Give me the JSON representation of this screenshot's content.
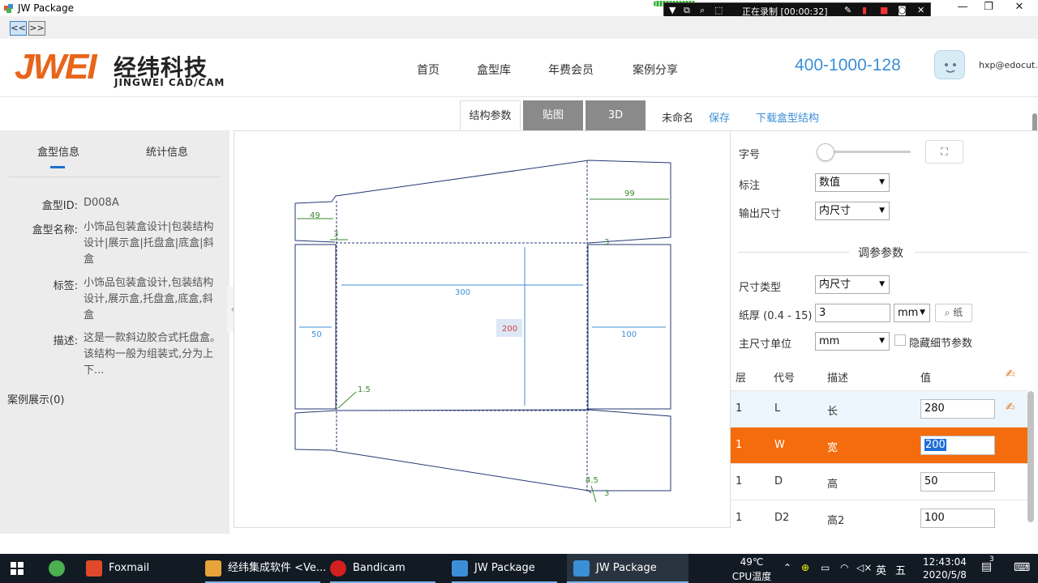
{
  "window": {
    "title": "JW Package",
    "minimize": "—",
    "maximize": "❐",
    "close": "✕"
  },
  "recorder": {
    "status": "正在录制 [00:00:32]"
  },
  "nav": {
    "back": "<<",
    "forward": ">>"
  },
  "header": {
    "logo_text": "JWEI",
    "logo_cn": "经纬科技",
    "logo_en": "JINGWEI CAD/CAM",
    "menu": [
      "首页",
      "盒型库",
      "年费会员",
      "案例分享"
    ],
    "phone": "400-1000-128",
    "email": "hxp@edocut."
  },
  "tabs": {
    "structure": "结构参数",
    "texture": "贴图",
    "three_d": "3D",
    "untitled": "未命名",
    "save": "保存",
    "download": "下载盒型结构"
  },
  "left": {
    "tab_info": "盒型信息",
    "tab_stats": "统计信息",
    "id_label": "盒型ID:",
    "id_value": "D008A",
    "name_label": "盒型名称:",
    "name_value": "小饰品包装盒设计|包装结构设计|展示盒|托盘盒|底盒|斜盒",
    "tags_label": "标签:",
    "tags_value": "小饰品包装盒设计,包装结构设计,展示盒,托盘盒,底盒,斜盒",
    "desc_label": "描述:",
    "desc_value": "这是一款斜边胶合式托盘盒。该结构一般为组装式,分为上下...",
    "cases": "案例展示(0)"
  },
  "canvas": {
    "dim_49": "49",
    "dim_99": "99",
    "dim_3a": "3",
    "dim_3b": "3",
    "dim_300": "300",
    "dim_200": "200",
    "dim_50": "50",
    "dim_100": "100",
    "dim_1_5": "1.5",
    "dim_4_5": "4.5",
    "dim_3c": "3"
  },
  "right": {
    "font_label": "字号",
    "mark_label": "标注",
    "mark_value": "数值",
    "output_label": "输出尺寸",
    "output_value": "内尺寸",
    "section": "调参参数",
    "dimtype_label": "尺寸类型",
    "dimtype_value": "内尺寸",
    "thick_label": "纸厚 (0.4 - 15)",
    "thick_value": "3",
    "thick_unit": "mm",
    "paper_btn": "纸",
    "unit_label": "主尺寸单位",
    "unit_value": "mm",
    "hide_label": "隐藏细节参数",
    "col_layer": "层",
    "col_code": "代号",
    "col_desc": "描述",
    "col_value": "值",
    "rows": [
      {
        "layer": "1",
        "code": "L",
        "desc": "长",
        "value": "280"
      },
      {
        "layer": "1",
        "code": "W",
        "desc": "宽",
        "value": "200"
      },
      {
        "layer": "1",
        "code": "D",
        "desc": "高",
        "value": "50"
      },
      {
        "layer": "1",
        "code": "D2",
        "desc": "高2",
        "value": "100"
      }
    ]
  },
  "taskbar": {
    "foxmail": "Foxmail",
    "jw_integrated": "经纬集成软件 <Ve...",
    "bandicam": "Bandicam",
    "jw1": "JW Package",
    "jw2": "JW Package",
    "temp": "49℃",
    "temp_label": "CPU温度",
    "ime1": "英",
    "ime2": "五",
    "time": "12:43:04",
    "date": "2020/5/8",
    "notif": "3"
  },
  "colors": {
    "accent_blue": "#3b8fd6",
    "highlight_orange": "#f46c0d",
    "dim_green": "#3a8a2f",
    "dim_blue": "#3f8fd8"
  }
}
